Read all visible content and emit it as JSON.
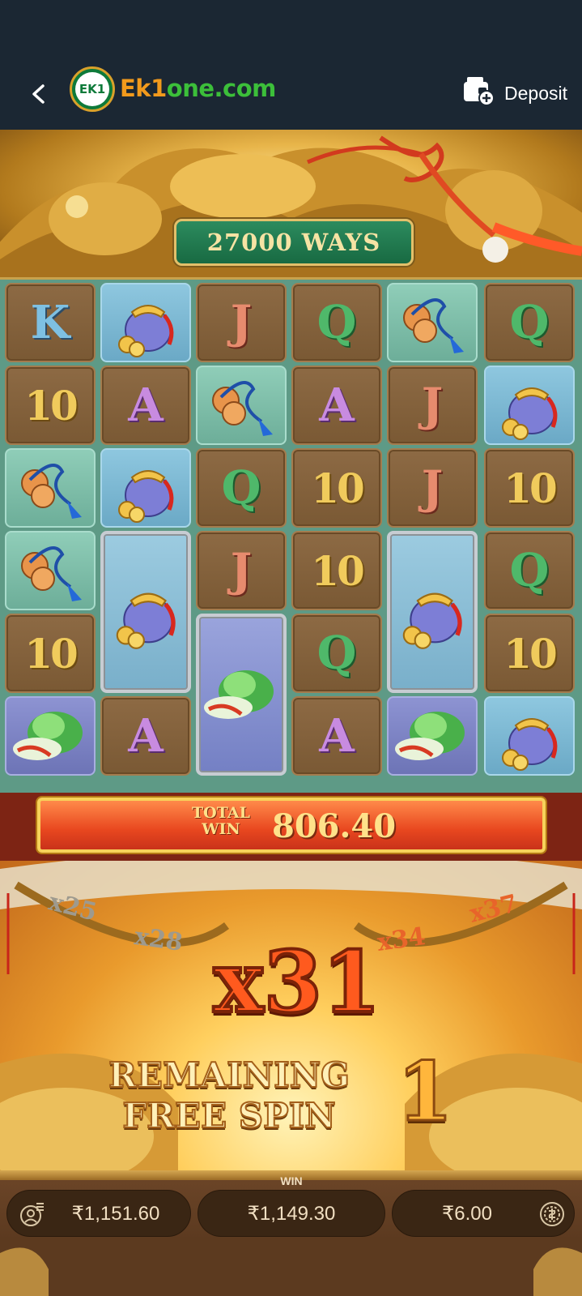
{
  "header": {
    "logo_badge_text": "EK1",
    "logo_text_a": "Ek1",
    "logo_text_b": "one.com",
    "deposit_label": "Deposit",
    "icons": [
      "back-arrow-icon",
      "wallet-plus-icon"
    ]
  },
  "banner": {
    "ways_label": "27000 WAYS"
  },
  "reels": {
    "columns": [
      [
        "K",
        "10",
        "coins",
        "coins",
        "10",
        "cabbage"
      ],
      [
        "pouch",
        "A",
        "pouch",
        "pouch-tall",
        "A"
      ],
      [
        "J",
        "coins",
        "Q",
        "J",
        "cabbage-tall"
      ],
      [
        "Q",
        "A",
        "10",
        "10",
        "Q",
        "A"
      ],
      [
        "coins",
        "J",
        "J",
        "pouch-tall",
        "cabbage"
      ],
      [
        "Q",
        "pouch",
        "10",
        "Q",
        "10",
        "pouch"
      ]
    ]
  },
  "total_win": {
    "label": "TOTAL WIN",
    "value": "806.40"
  },
  "multiplier": {
    "trail_left": [
      "x25",
      "x28"
    ],
    "current": "x31",
    "trail_right": [
      "x34",
      "x37"
    ]
  },
  "free_spin": {
    "label_line1": "REMAINING",
    "label_line2": "FREE SPIN",
    "count": "1"
  },
  "bottom_bar": {
    "balance": "₹1,151.60",
    "win_caption": "WIN",
    "win": "₹1,149.30",
    "bet": "₹6.00"
  },
  "colors": {
    "header_bg": "#1b2733",
    "logo_orange": "#f29a1c",
    "logo_green": "#3cbf3a",
    "ways_green": "#2c8b5e",
    "win_red": "#e8471f",
    "gold": "#f0cb5c"
  }
}
